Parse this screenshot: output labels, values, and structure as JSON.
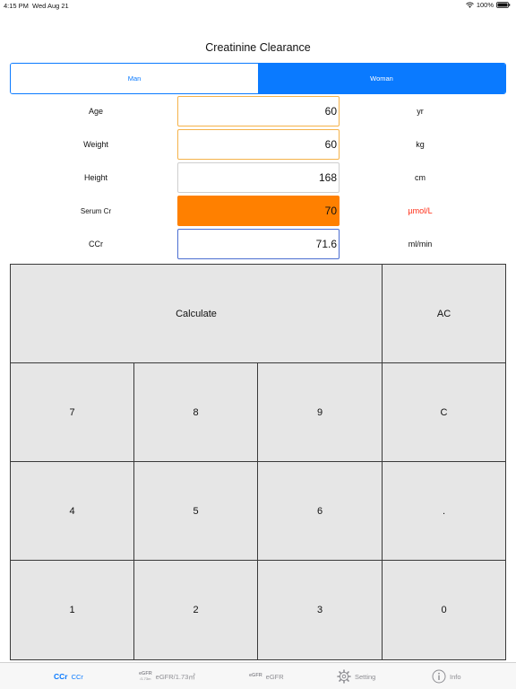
{
  "status_bar": {
    "time": "4:15 PM",
    "date": "Wed Aug 21",
    "battery": "100%"
  },
  "title": "Creatinine Clearance",
  "gender": {
    "options": [
      "Man",
      "Woman"
    ],
    "selected": "Woman"
  },
  "fields": {
    "age": {
      "label": "Age",
      "value": "60",
      "unit": "yr"
    },
    "weight": {
      "label": "Weight",
      "value": "60",
      "unit": "kg"
    },
    "height": {
      "label": "Height",
      "value": "168",
      "unit": "cm"
    },
    "serum_cr": {
      "label": "Serum Cr",
      "value": "70",
      "unit": "µmol/L"
    },
    "ccr": {
      "label": "CCr",
      "value": "71.6",
      "unit": "ml/min"
    }
  },
  "keypad": {
    "calculate": "Calculate",
    "ac": "AC",
    "c": "C",
    "dot": ".",
    "digits": [
      "0",
      "1",
      "2",
      "3",
      "4",
      "5",
      "6",
      "7",
      "8",
      "9"
    ]
  },
  "tabs": [
    {
      "icon_text": "CCr",
      "label": "CCr"
    },
    {
      "icon_text": "eGFR",
      "icon_sub": "/1.73m",
      "label": "eGFR/1.73㎡"
    },
    {
      "icon_text": "eGFR",
      "label": "eGFR"
    },
    {
      "icon": "gear-icon",
      "label": "Setting"
    },
    {
      "icon": "info-icon",
      "label": "Info"
    }
  ],
  "colors": {
    "accent": "#0a7aff",
    "active_field": "#ff8000",
    "unit_highlight": "#ff2d16",
    "key_background": "#e6e6e6"
  }
}
